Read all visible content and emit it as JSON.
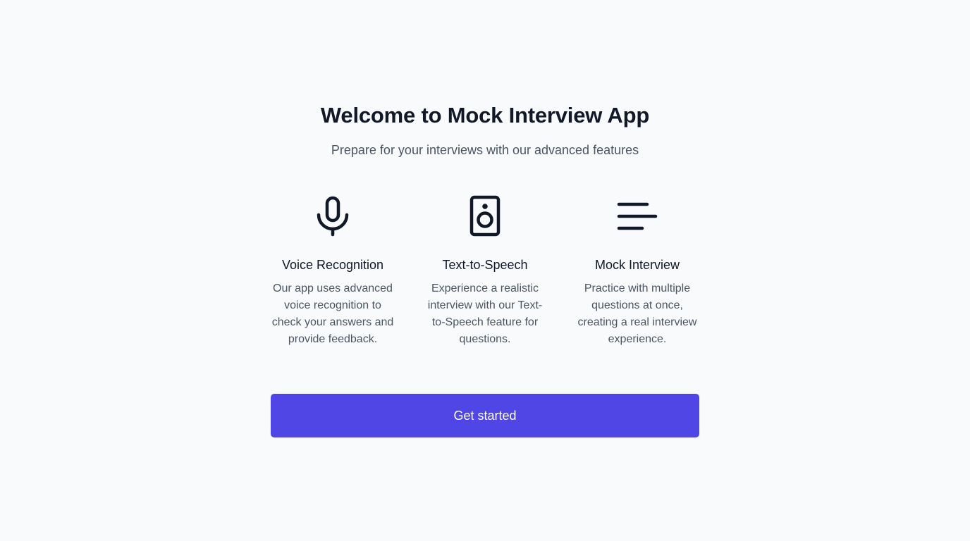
{
  "hero": {
    "title": "Welcome to Mock Interview App",
    "subtitle": "Prepare for your interviews with our advanced features"
  },
  "features": [
    {
      "icon": "microphone-icon",
      "title": "Voice Recognition",
      "description": "Our app uses advanced voice recognition to check your answers and provide feedback."
    },
    {
      "icon": "speaker-icon",
      "title": "Text-to-Speech",
      "description": "Experience a realistic interview with our Text-to-Speech feature for questions."
    },
    {
      "icon": "text-lines-icon",
      "title": "Mock Interview",
      "description": "Practice with multiple questions at once, creating a real interview experience."
    }
  ],
  "cta": {
    "label": "Get started"
  },
  "colors": {
    "background": "#f8fafc",
    "heading": "#111827",
    "body_text": "#4b5563",
    "accent": "#4f46e5"
  }
}
